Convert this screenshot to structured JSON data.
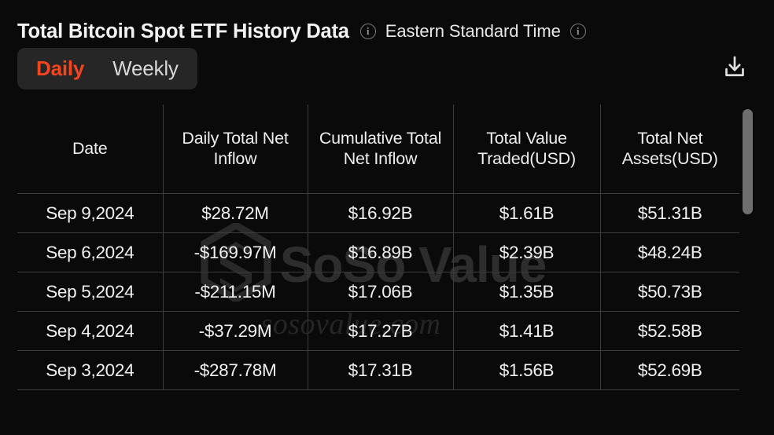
{
  "header": {
    "title": "Total Bitcoin Spot ETF History Data",
    "title_info_icon": "info-icon",
    "timezone_label": "Eastern Standard Time",
    "timezone_info_icon": "info-icon"
  },
  "toolbar": {
    "tabs": [
      {
        "label": "Daily",
        "active": true
      },
      {
        "label": "Weekly",
        "active": false
      }
    ],
    "download_icon": "download-icon"
  },
  "table": {
    "columns": [
      "Date",
      "Daily Total Net Inflow",
      "Cumulative Total Net Inflow",
      "Total Value Traded(USD)",
      "Total Net Assets(USD)"
    ],
    "rows": [
      {
        "date": "Sep 9,2024",
        "daily_net_inflow": "$28.72M",
        "daily_sign": "positive",
        "cumulative_net_inflow": "$16.92B",
        "total_value_traded": "$1.61B",
        "total_net_assets": "$51.31B"
      },
      {
        "date": "Sep 6,2024",
        "daily_net_inflow": "-$169.97M",
        "daily_sign": "negative",
        "cumulative_net_inflow": "$16.89B",
        "total_value_traded": "$2.39B",
        "total_net_assets": "$48.24B"
      },
      {
        "date": "Sep 5,2024",
        "daily_net_inflow": "-$211.15M",
        "daily_sign": "negative",
        "cumulative_net_inflow": "$17.06B",
        "total_value_traded": "$1.35B",
        "total_net_assets": "$50.73B"
      },
      {
        "date": "Sep 4,2024",
        "daily_net_inflow": "-$37.29M",
        "daily_sign": "negative",
        "cumulative_net_inflow": "$17.27B",
        "total_value_traded": "$1.41B",
        "total_net_assets": "$52.58B"
      },
      {
        "date": "Sep 3,2024",
        "daily_net_inflow": "-$287.78M",
        "daily_sign": "negative",
        "cumulative_net_inflow": "$17.31B",
        "total_value_traded": "$1.56B",
        "total_net_assets": "$52.69B"
      }
    ]
  },
  "watermark": {
    "brand": "SoSo Value",
    "domain": "sosovalue.com",
    "logo_icon": "sosovalue-hexagon-logo"
  },
  "colors": {
    "background": "#0a0a0a",
    "tab_container": "#262626",
    "accent_active": "#f5451e",
    "positive": "#17c964",
    "negative": "#f31b1b",
    "border": "#3d3d3d",
    "text": "#f0f0f0",
    "scrollbar_thumb": "#6e6e6e"
  }
}
